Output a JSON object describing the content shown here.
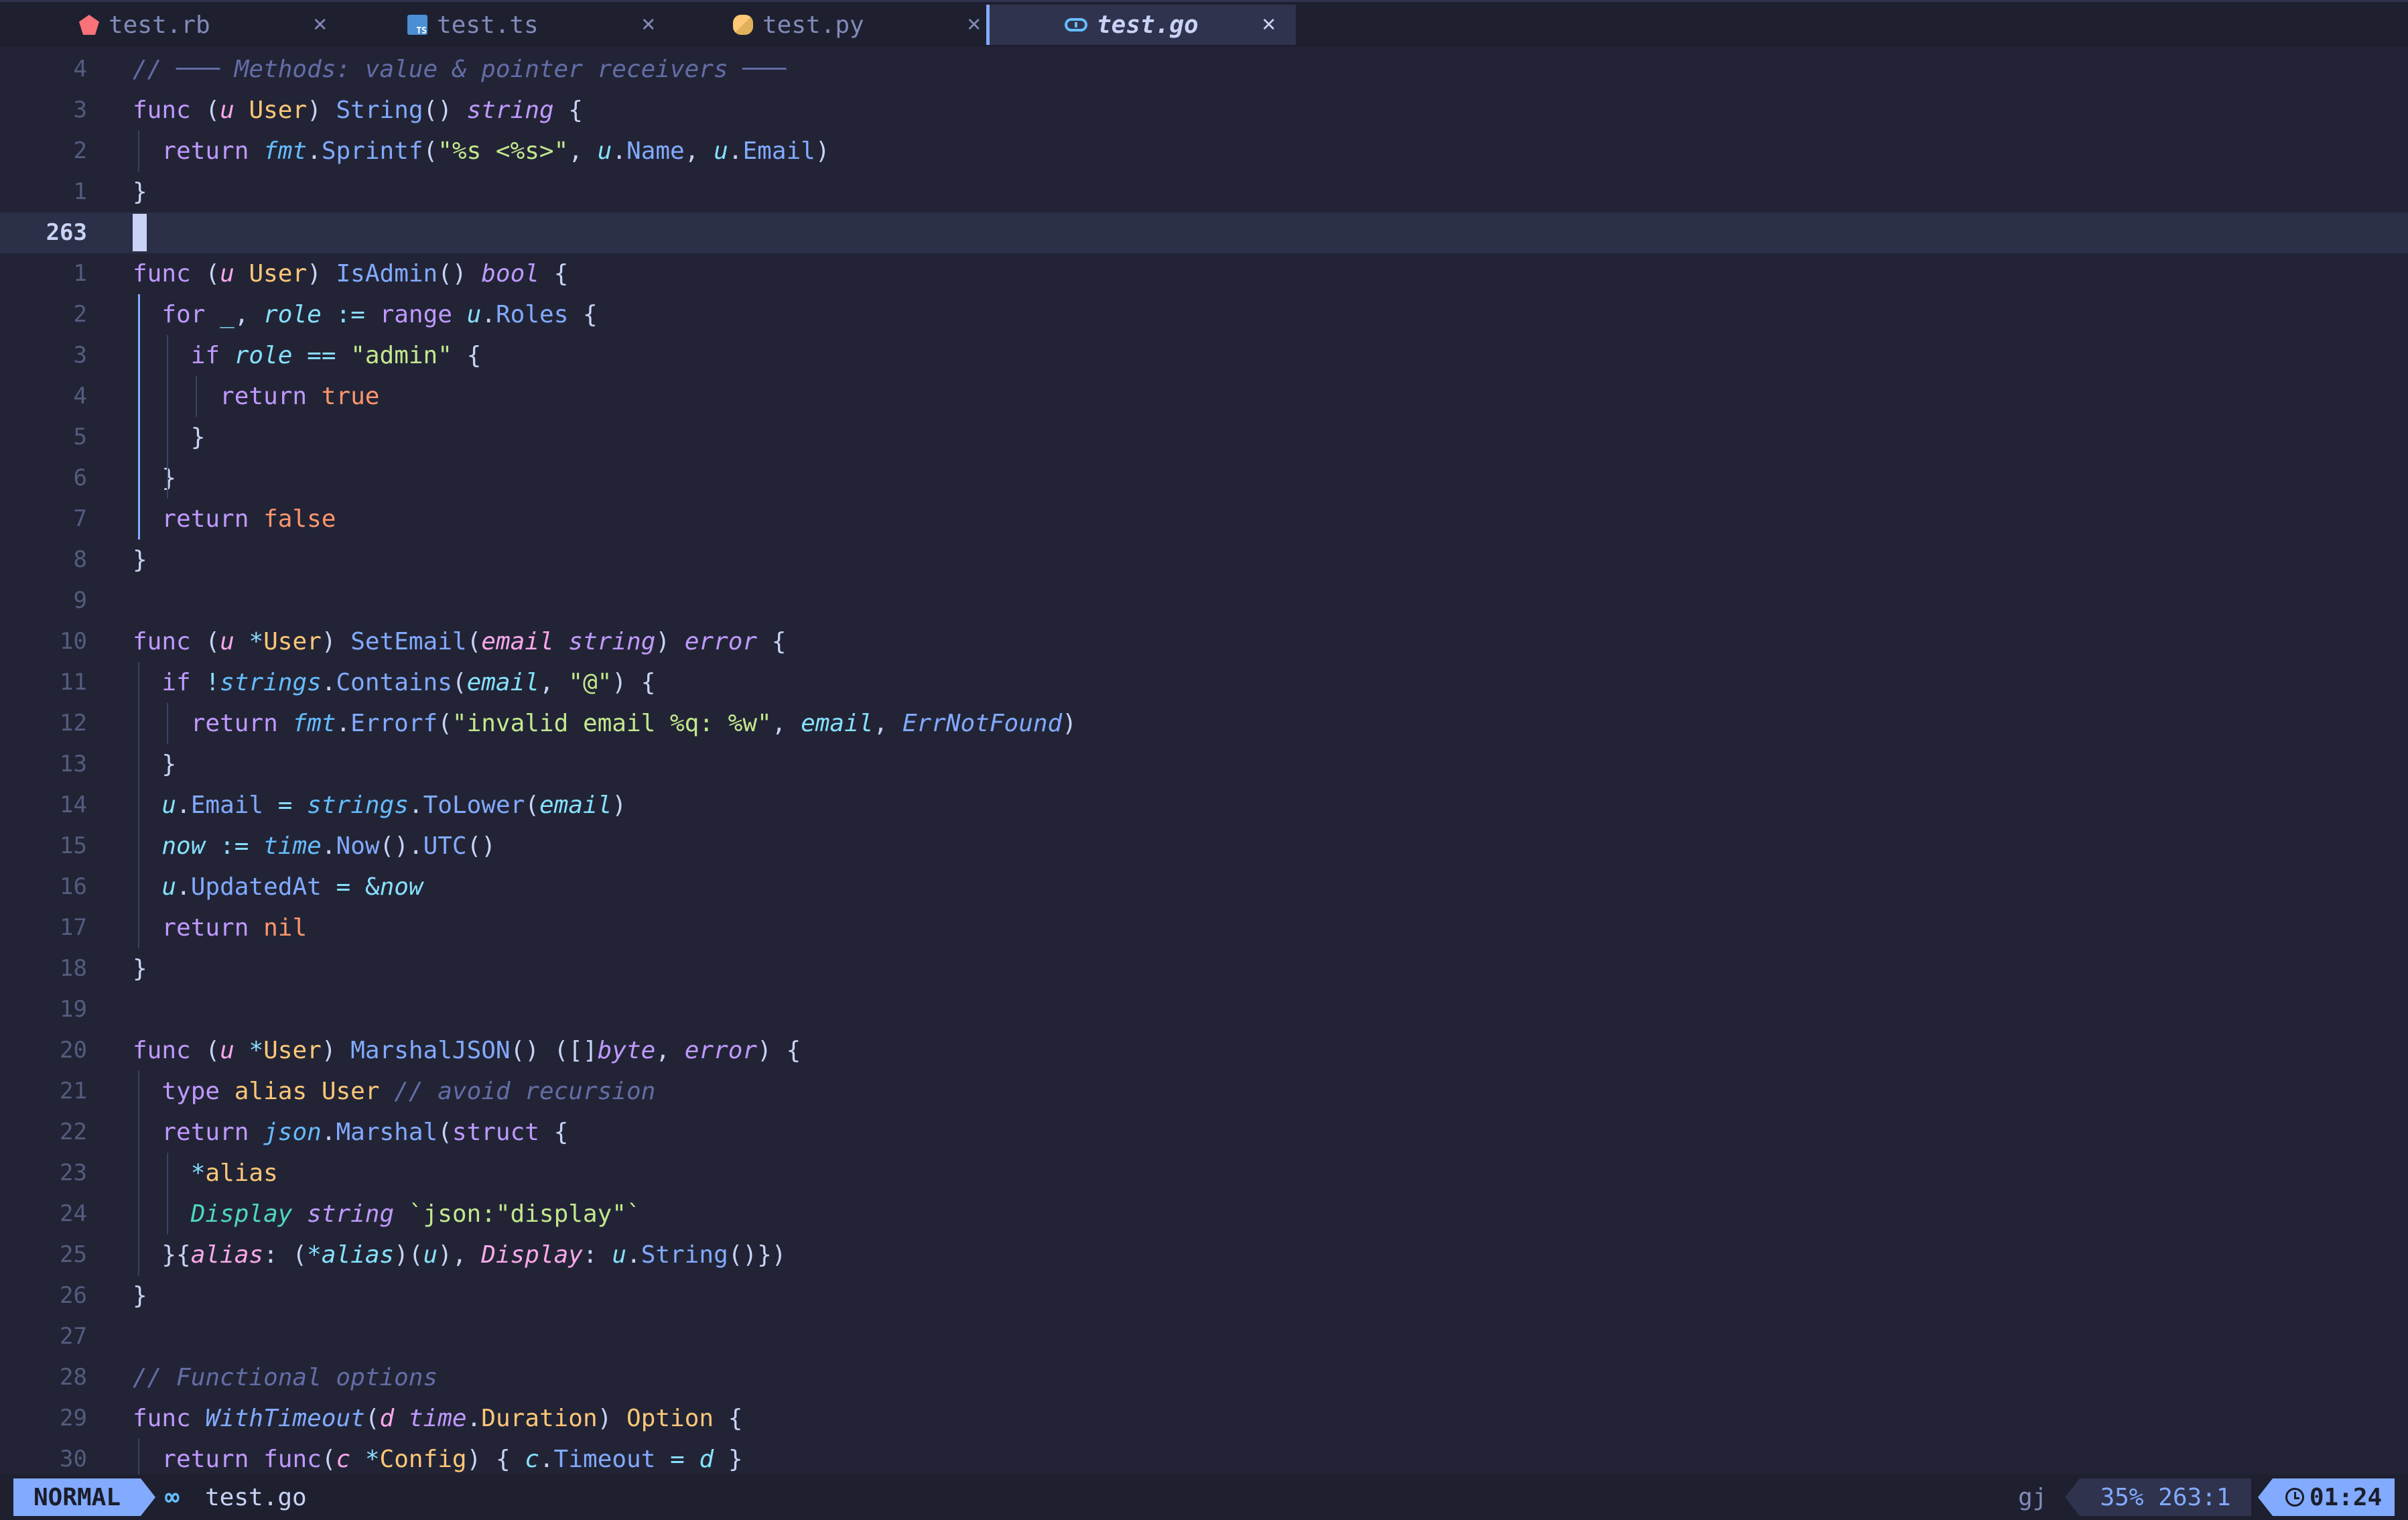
{
  "tabs": [
    {
      "label": "test.rb",
      "icon": "ruby-icon",
      "active": false
    },
    {
      "label": "test.ts",
      "icon": "typescript-icon",
      "active": false
    },
    {
      "label": "test.py",
      "icon": "python-icon",
      "active": false
    },
    {
      "label": "test.go",
      "icon": "go-icon",
      "active": true
    }
  ],
  "tab_close_glyph": "✕",
  "editor": {
    "current_line": "263",
    "lines": [
      {
        "num": "4",
        "tokens": [
          [
            "c",
            "// ─── Methods: value & pointer receivers ───"
          ]
        ]
      },
      {
        "num": "3",
        "tokens": [
          [
            "k",
            "func"
          ],
          [
            "pu",
            " ("
          ],
          [
            "p",
            "u"
          ],
          [
            "pu",
            " "
          ],
          [
            "t",
            "User"
          ],
          [
            "pu",
            ") "
          ],
          [
            "f",
            "String"
          ],
          [
            "pu",
            "() "
          ],
          [
            "ti",
            "string"
          ],
          [
            "pu",
            " {"
          ]
        ]
      },
      {
        "num": "2",
        "tokens": [
          [
            "pu",
            "  "
          ],
          [
            "k",
            "return"
          ],
          [
            "pu",
            " "
          ],
          [
            "pk",
            "fmt"
          ],
          [
            "pu",
            "."
          ],
          [
            "f",
            "Sprintf"
          ],
          [
            "pu",
            "("
          ],
          [
            "s",
            "\"%s <%s>\""
          ],
          [
            "pu",
            ", "
          ],
          [
            "v",
            "u"
          ],
          [
            "pu",
            "."
          ],
          [
            "f",
            "Name"
          ],
          [
            "pu",
            ", "
          ],
          [
            "v",
            "u"
          ],
          [
            "pu",
            "."
          ],
          [
            "f",
            "Email"
          ],
          [
            "pu",
            ")"
          ]
        ]
      },
      {
        "num": "1",
        "tokens": [
          [
            "pu",
            "}"
          ]
        ]
      },
      {
        "num": "263",
        "tokens": []
      },
      {
        "num": "1",
        "tokens": [
          [
            "k",
            "func"
          ],
          [
            "pu",
            " ("
          ],
          [
            "p",
            "u"
          ],
          [
            "pu",
            " "
          ],
          [
            "t",
            "User"
          ],
          [
            "pu",
            ") "
          ],
          [
            "f",
            "IsAdmin"
          ],
          [
            "pu",
            "() "
          ],
          [
            "ti",
            "bool"
          ],
          [
            "pu",
            " {"
          ]
        ]
      },
      {
        "num": "2",
        "tokens": [
          [
            "pu",
            "  "
          ],
          [
            "k",
            "for"
          ],
          [
            "pu",
            " "
          ],
          [
            "v",
            "_"
          ],
          [
            "pu",
            ", "
          ],
          [
            "v",
            "role"
          ],
          [
            "pu",
            " "
          ],
          [
            "op",
            ":="
          ],
          [
            "pu",
            " "
          ],
          [
            "k",
            "range"
          ],
          [
            "pu",
            " "
          ],
          [
            "v",
            "u"
          ],
          [
            "pu",
            "."
          ],
          [
            "f",
            "Roles"
          ],
          [
            "pu",
            " {"
          ]
        ]
      },
      {
        "num": "3",
        "tokens": [
          [
            "pu",
            "    "
          ],
          [
            "k",
            "if"
          ],
          [
            "pu",
            " "
          ],
          [
            "v",
            "role"
          ],
          [
            "pu",
            " "
          ],
          [
            "op",
            "=="
          ],
          [
            "pu",
            " "
          ],
          [
            "s",
            "\"admin\""
          ],
          [
            "pu",
            " {"
          ]
        ]
      },
      {
        "num": "4",
        "tokens": [
          [
            "pu",
            "      "
          ],
          [
            "k",
            "return"
          ],
          [
            "pu",
            " "
          ],
          [
            "b",
            "true"
          ]
        ]
      },
      {
        "num": "5",
        "tokens": [
          [
            "pu",
            "    }"
          ]
        ]
      },
      {
        "num": "6",
        "tokens": [
          [
            "pu",
            "  }"
          ]
        ]
      },
      {
        "num": "7",
        "tokens": [
          [
            "pu",
            "  "
          ],
          [
            "k",
            "return"
          ],
          [
            "pu",
            " "
          ],
          [
            "b",
            "false"
          ]
        ]
      },
      {
        "num": "8",
        "tokens": [
          [
            "pu",
            "}"
          ]
        ]
      },
      {
        "num": "9",
        "tokens": []
      },
      {
        "num": "10",
        "tokens": [
          [
            "k",
            "func"
          ],
          [
            "pu",
            " ("
          ],
          [
            "p",
            "u"
          ],
          [
            "pu",
            " "
          ],
          [
            "op",
            "*"
          ],
          [
            "t",
            "User"
          ],
          [
            "pu",
            ") "
          ],
          [
            "f",
            "SetEmail"
          ],
          [
            "pu",
            "("
          ],
          [
            "p",
            "email"
          ],
          [
            "pu",
            " "
          ],
          [
            "ti",
            "string"
          ],
          [
            "pu",
            ") "
          ],
          [
            "ti",
            "error"
          ],
          [
            "pu",
            " {"
          ]
        ]
      },
      {
        "num": "11",
        "tokens": [
          [
            "pu",
            "  "
          ],
          [
            "k",
            "if"
          ],
          [
            "pu",
            " "
          ],
          [
            "op",
            "!"
          ],
          [
            "pk",
            "strings"
          ],
          [
            "pu",
            "."
          ],
          [
            "f",
            "Contains"
          ],
          [
            "pu",
            "("
          ],
          [
            "v",
            "email"
          ],
          [
            "pu",
            ", "
          ],
          [
            "s",
            "\"@\""
          ],
          [
            "pu",
            ") {"
          ]
        ]
      },
      {
        "num": "12",
        "tokens": [
          [
            "pu",
            "    "
          ],
          [
            "k",
            "return"
          ],
          [
            "pu",
            " "
          ],
          [
            "pk",
            "fmt"
          ],
          [
            "pu",
            "."
          ],
          [
            "f",
            "Errorf"
          ],
          [
            "pu",
            "("
          ],
          [
            "s",
            "\"invalid email %q: %w\""
          ],
          [
            "pu",
            ", "
          ],
          [
            "v",
            "email"
          ],
          [
            "pu",
            ", "
          ],
          [
            "fi",
            "ErrNotFound"
          ],
          [
            "pu",
            ")"
          ]
        ]
      },
      {
        "num": "13",
        "tokens": [
          [
            "pu",
            "  }"
          ]
        ]
      },
      {
        "num": "14",
        "tokens": [
          [
            "pu",
            "  "
          ],
          [
            "v",
            "u"
          ],
          [
            "pu",
            "."
          ],
          [
            "f",
            "Email"
          ],
          [
            "pu",
            " "
          ],
          [
            "op",
            "="
          ],
          [
            "pu",
            " "
          ],
          [
            "pk",
            "strings"
          ],
          [
            "pu",
            "."
          ],
          [
            "f",
            "ToLower"
          ],
          [
            "pu",
            "("
          ],
          [
            "v",
            "email"
          ],
          [
            "pu",
            ")"
          ]
        ]
      },
      {
        "num": "15",
        "tokens": [
          [
            "pu",
            "  "
          ],
          [
            "v",
            "now"
          ],
          [
            "pu",
            " "
          ],
          [
            "op",
            ":="
          ],
          [
            "pu",
            " "
          ],
          [
            "pk",
            "time"
          ],
          [
            "pu",
            "."
          ],
          [
            "f",
            "Now"
          ],
          [
            "pu",
            "()."
          ],
          [
            "f",
            "UTC"
          ],
          [
            "pu",
            "()"
          ]
        ]
      },
      {
        "num": "16",
        "tokens": [
          [
            "pu",
            "  "
          ],
          [
            "v",
            "u"
          ],
          [
            "pu",
            "."
          ],
          [
            "f",
            "UpdatedAt"
          ],
          [
            "pu",
            " "
          ],
          [
            "op",
            "="
          ],
          [
            "pu",
            " "
          ],
          [
            "op",
            "&"
          ],
          [
            "v",
            "now"
          ]
        ]
      },
      {
        "num": "17",
        "tokens": [
          [
            "pu",
            "  "
          ],
          [
            "k",
            "return"
          ],
          [
            "pu",
            " "
          ],
          [
            "b",
            "nil"
          ]
        ]
      },
      {
        "num": "18",
        "tokens": [
          [
            "pu",
            "}"
          ]
        ]
      },
      {
        "num": "19",
        "tokens": []
      },
      {
        "num": "20",
        "tokens": [
          [
            "k",
            "func"
          ],
          [
            "pu",
            " ("
          ],
          [
            "p",
            "u"
          ],
          [
            "pu",
            " "
          ],
          [
            "op",
            "*"
          ],
          [
            "t",
            "User"
          ],
          [
            "pu",
            ") "
          ],
          [
            "f",
            "MarshalJSON"
          ],
          [
            "pu",
            "() ([]"
          ],
          [
            "ti",
            "byte"
          ],
          [
            "pu",
            ", "
          ],
          [
            "ti",
            "error"
          ],
          [
            "pu",
            ") {"
          ]
        ]
      },
      {
        "num": "21",
        "tokens": [
          [
            "pu",
            "  "
          ],
          [
            "k",
            "type"
          ],
          [
            "pu",
            " "
          ],
          [
            "t",
            "alias"
          ],
          [
            "pu",
            " "
          ],
          [
            "t",
            "User"
          ],
          [
            "pu",
            " "
          ],
          [
            "c",
            "// avoid recursion"
          ]
        ]
      },
      {
        "num": "22",
        "tokens": [
          [
            "pu",
            "  "
          ],
          [
            "k",
            "return"
          ],
          [
            "pu",
            " "
          ],
          [
            "pk",
            "json"
          ],
          [
            "pu",
            "."
          ],
          [
            "f",
            "Marshal"
          ],
          [
            "pu",
            "("
          ],
          [
            "k",
            "struct"
          ],
          [
            "pu",
            " {"
          ]
        ]
      },
      {
        "num": "23",
        "tokens": [
          [
            "pu",
            "    "
          ],
          [
            "op",
            "*"
          ],
          [
            "t",
            "alias"
          ]
        ]
      },
      {
        "num": "24",
        "tokens": [
          [
            "pu",
            "    "
          ],
          [
            "e",
            "Display"
          ],
          [
            "pu",
            " "
          ],
          [
            "ti",
            "string"
          ],
          [
            "pu",
            " "
          ],
          [
            "s",
            "`json:\"display\"`"
          ]
        ]
      },
      {
        "num": "25",
        "tokens": [
          [
            "pu",
            "  }{"
          ],
          [
            "fl",
            "alias"
          ],
          [
            "pu",
            ": ("
          ],
          [
            "op",
            "*"
          ],
          [
            "v",
            "alias"
          ],
          [
            "pu",
            ")("
          ],
          [
            "v",
            "u"
          ],
          [
            "pu",
            "), "
          ],
          [
            "fl",
            "Display"
          ],
          [
            "pu",
            ": "
          ],
          [
            "v",
            "u"
          ],
          [
            "pu",
            "."
          ],
          [
            "f",
            "String"
          ],
          [
            "pu",
            "()})"
          ]
        ]
      },
      {
        "num": "26",
        "tokens": [
          [
            "pu",
            "}"
          ]
        ]
      },
      {
        "num": "27",
        "tokens": []
      },
      {
        "num": "28",
        "tokens": [
          [
            "c",
            "// Functional options"
          ]
        ]
      },
      {
        "num": "29",
        "tokens": [
          [
            "k",
            "func"
          ],
          [
            "pu",
            " "
          ],
          [
            "fi",
            "WithTimeout"
          ],
          [
            "pu",
            "("
          ],
          [
            "p",
            "d"
          ],
          [
            "pu",
            " "
          ],
          [
            "ti",
            "time"
          ],
          [
            "pu",
            "."
          ],
          [
            "t",
            "Duration"
          ],
          [
            "pu",
            ") "
          ],
          [
            "t",
            "Option"
          ],
          [
            "pu",
            " {"
          ]
        ]
      },
      {
        "num": "30",
        "tokens": [
          [
            "pu",
            "  "
          ],
          [
            "k",
            "return"
          ],
          [
            "pu",
            " "
          ],
          [
            "k",
            "func"
          ],
          [
            "pu",
            "("
          ],
          [
            "p",
            "c"
          ],
          [
            "pu",
            " "
          ],
          [
            "op",
            "*"
          ],
          [
            "t",
            "Config"
          ],
          [
            "pu",
            ") { "
          ],
          [
            "v",
            "c"
          ],
          [
            "pu",
            "."
          ],
          [
            "f",
            "Timeout"
          ],
          [
            "pu",
            " "
          ],
          [
            "op",
            "="
          ],
          [
            "pu",
            " "
          ],
          [
            "v",
            "d"
          ],
          [
            "pu",
            " }"
          ]
        ]
      }
    ]
  },
  "statusline": {
    "mode": "NORMAL",
    "file_icon": "go-icon",
    "file_icon_glyph": "∞",
    "filename": "test.go",
    "pending_keys": "gj",
    "position": "35% 263:1",
    "clock_icon": "clock-icon",
    "time": "01:24"
  }
}
